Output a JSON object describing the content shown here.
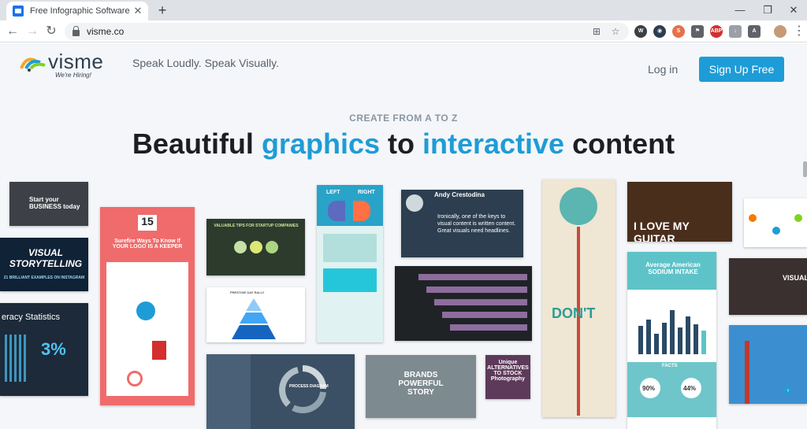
{
  "browser": {
    "tab_title": "Free Infographic Software and Pr",
    "url": "visme.co"
  },
  "header": {
    "logo_text": "visme",
    "logo_sub": "We're Hiring!",
    "tagline": "Speak Loudly. Speak Visually.",
    "login_label": "Log in",
    "signup_label": "Sign Up Free"
  },
  "hero": {
    "eyebrow": "CREATE FROM A TO Z",
    "headline_part1": "Beautiful ",
    "headline_accent1": "graphics",
    "headline_part2": " to ",
    "headline_accent2": "interactive",
    "headline_part3": " content"
  },
  "tiles": {
    "business": "Start your BUSINESS today",
    "storytelling": "VISUAL STORYTELLING",
    "storytelling_sub": "21 BRILLIANT EXAMPLES ON INSTAGRAM",
    "literacy": "eracy Statistics",
    "literacy_pct": "3%",
    "logo_num": "15",
    "logo_title": "Surefire Ways To Know If YOUR LOGO IS A KEEPER",
    "startup": "VALUABLE TIPS FOR STARTUP COMPANIES",
    "pyramid": "PRESTIGE DAY RALLY",
    "left_brain": "LEFT",
    "right_brain": "RIGHT",
    "andy_name": "Andy Crestodina",
    "andy_quote": "Ironically, one of the keys to visual content is written content. Great visuals need headlines.",
    "dont": "DON'T",
    "guitar": "I LOVE MY GUITAR",
    "sodium_title": "Average American SODIUM INTAKE",
    "facts": "FACTS",
    "pct1": "90%",
    "pct2": "44%",
    "brands": "BRANDS POWERFUL STORY",
    "stock": "Unique ALTERNATIVES TO STOCK Photography",
    "process": "PROCESS DIAGRAM",
    "visual": "VISUAL"
  },
  "colors": {
    "accent": "#1e9cd7",
    "headline": "#1c1e21"
  }
}
